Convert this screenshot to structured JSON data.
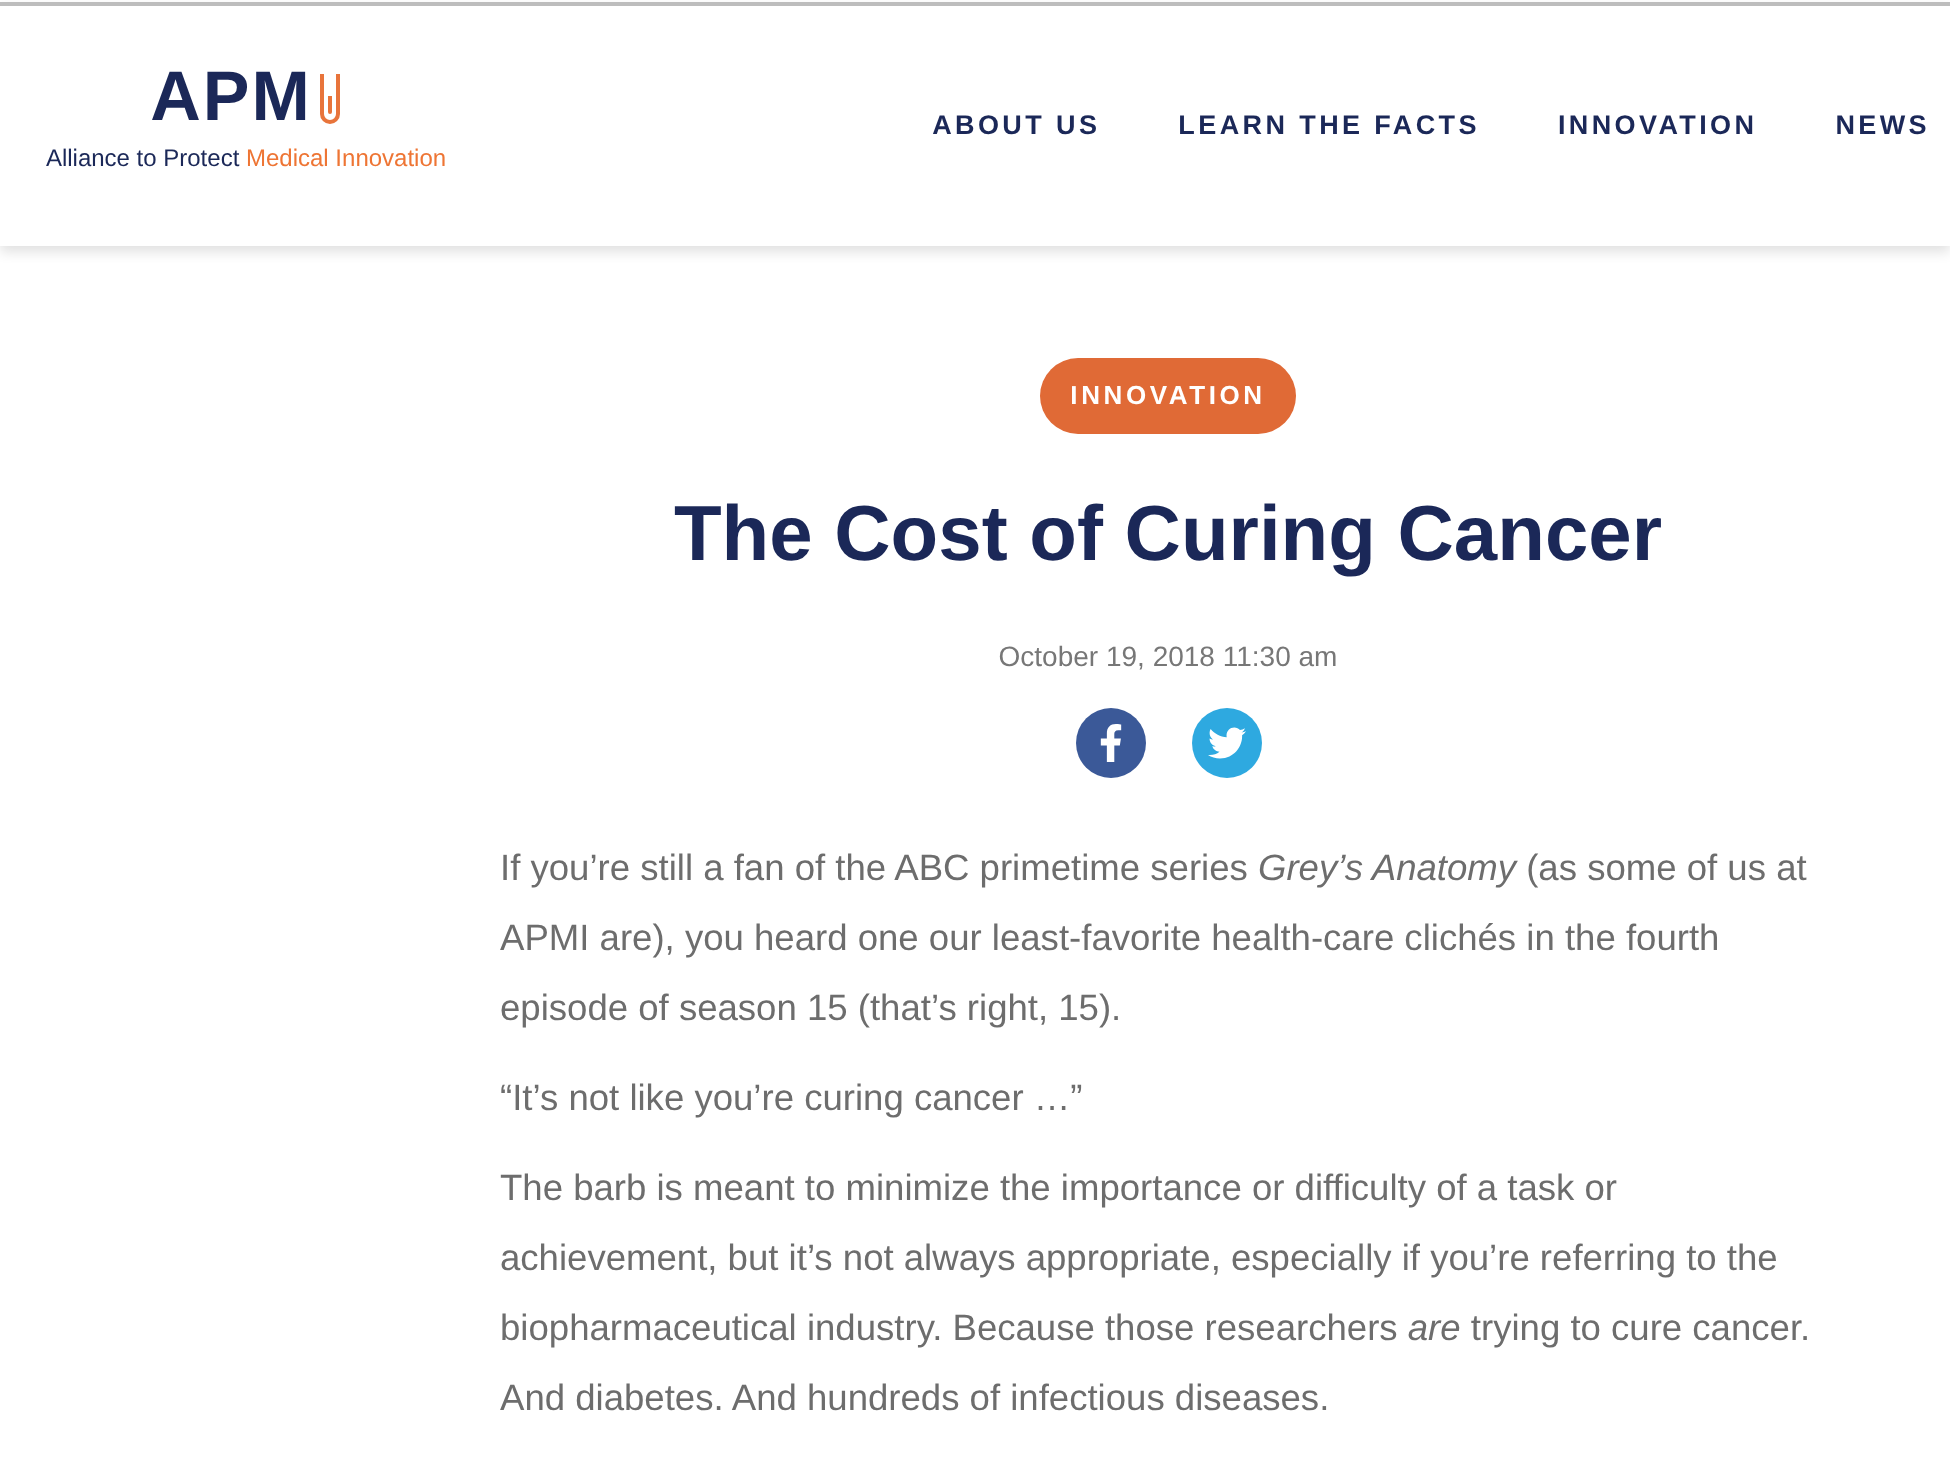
{
  "header": {
    "logo": {
      "mark": "APM",
      "tagline_lead": "Alliance to Protect",
      "tagline_accent": "Medical Innovation"
    },
    "nav": [
      "ABOUT US",
      "LEARN THE FACTS",
      "INNOVATION",
      "NEWS"
    ]
  },
  "article": {
    "category": "INNOVATION",
    "title": "The Cost of Curing Cancer",
    "date": "October 19, 2018 11:30 am",
    "paragraphs": [
      "If you’re still a fan of the ABC primetime series *Grey’s Anatomy* (as some of us at APMI are), you heard one our least-favorite health-care clichés in the fourth episode of season 15 (that’s right, 15).",
      "“It’s not like you’re curing cancer …”",
      "The barb is meant to minimize the importance or difficulty of a task or achievement, but it’s not always appropriate, especially if you’re referring to the biopharmaceutical industry. Because those researchers *are* trying to cure cancer. And diabetes. And hundreds of infectious diseases."
    ]
  }
}
